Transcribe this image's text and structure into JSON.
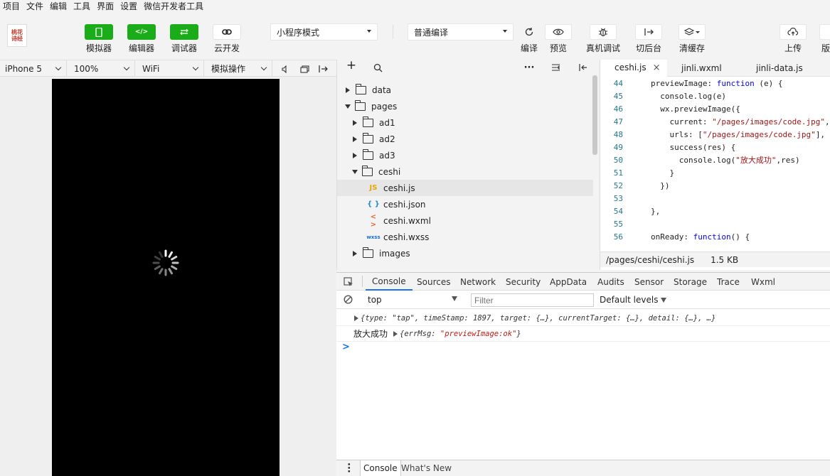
{
  "menu": [
    "项目",
    "文件",
    "编辑",
    "工具",
    "界面",
    "设置",
    "微信开发者工具"
  ],
  "logo_text": "桃花诗经",
  "toolbar": {
    "simulator": "模拟器",
    "editor": "编辑器",
    "debugger": "调试器",
    "cloud": "云开发",
    "mode_select": "小程序模式",
    "compile_select": "普通编译",
    "compile": "编译",
    "preview": "预览",
    "real_debug": "真机调试",
    "background": "切后台",
    "clear_cache": "清缓存",
    "upload": "上传",
    "version": "版"
  },
  "simbar": {
    "device": "iPhone 5",
    "zoom": "100%",
    "network": "WiFi",
    "action": "模拟操作"
  },
  "tree": [
    {
      "label": "data",
      "type": "folder",
      "expanded": false
    },
    {
      "label": "pages",
      "type": "folder",
      "expanded": true
    },
    {
      "label": "ad1",
      "type": "folder",
      "expanded": false
    },
    {
      "label": "ad2",
      "type": "folder",
      "expanded": false
    },
    {
      "label": "ad3",
      "type": "folder",
      "expanded": false
    },
    {
      "label": "ceshi",
      "type": "folder",
      "expanded": true
    },
    {
      "label": "ceshi.js",
      "type": "file",
      "icon": "JS"
    },
    {
      "label": "ceshi.json",
      "type": "file",
      "icon": "{ }"
    },
    {
      "label": "ceshi.wxml",
      "type": "file",
      "icon": "< >"
    },
    {
      "label": "ceshi.wxss",
      "type": "file",
      "icon": "wxss"
    },
    {
      "label": "images",
      "type": "folder",
      "expanded": false
    }
  ],
  "tabs": [
    "ceshi.js",
    "jinli.wxml",
    "jinli-data.js"
  ],
  "code": {
    "line_numbers": [
      "44",
      "45",
      "46",
      "47",
      "48",
      "49",
      "50",
      "51",
      "52",
      "53",
      "54",
      "55",
      "56"
    ],
    "l44a": "previewImage: ",
    "l44kw": "function",
    "l44b": " (e) {",
    "l45": "  console.log(e)",
    "l46": "  wx.previewImage({",
    "l47a": "    current: ",
    "l47s": "\"/pages/images/code.jpg\"",
    "l47b": ",",
    "l48a": "    urls: [",
    "l48s": "\"/pages/images/code.jpg\"",
    "l48b": "],",
    "l49": "    success(res) {",
    "l50a": "      console.log(",
    "l50s": "\"放大成功\"",
    "l50b": ",res)",
    "l51": "    }",
    "l52": "  })",
    "l53": "",
    "l54": "},",
    "l55": "",
    "l56a": "onReady: ",
    "l56kw": "function",
    "l56b": "() {"
  },
  "file_status": {
    "path": "/pages/ceshi/ceshi.js",
    "size": "1.5 KB"
  },
  "devtools_tabs": [
    "Console",
    "Sources",
    "Network",
    "Security",
    "AppData",
    "Audits",
    "Sensor",
    "Storage",
    "Trace",
    "Wxml"
  ],
  "console": {
    "context": "top",
    "filter_placeholder": "Filter",
    "levels": "Default levels",
    "log1": "{type: \"tap\", timeStamp: 1897, target: {…}, currentTarget: {…}, detail: {…}, …}",
    "log2_prefix": "放大成功",
    "log2_obj_a": "{errMsg: ",
    "log2_obj_s": "\"previewImage:ok\"",
    "log2_obj_b": "}",
    "prompt": ">"
  },
  "drawer_tabs": [
    "Console",
    "What's New"
  ],
  "colors": {
    "green": "#1aad19",
    "accent": "#1a73e8"
  }
}
